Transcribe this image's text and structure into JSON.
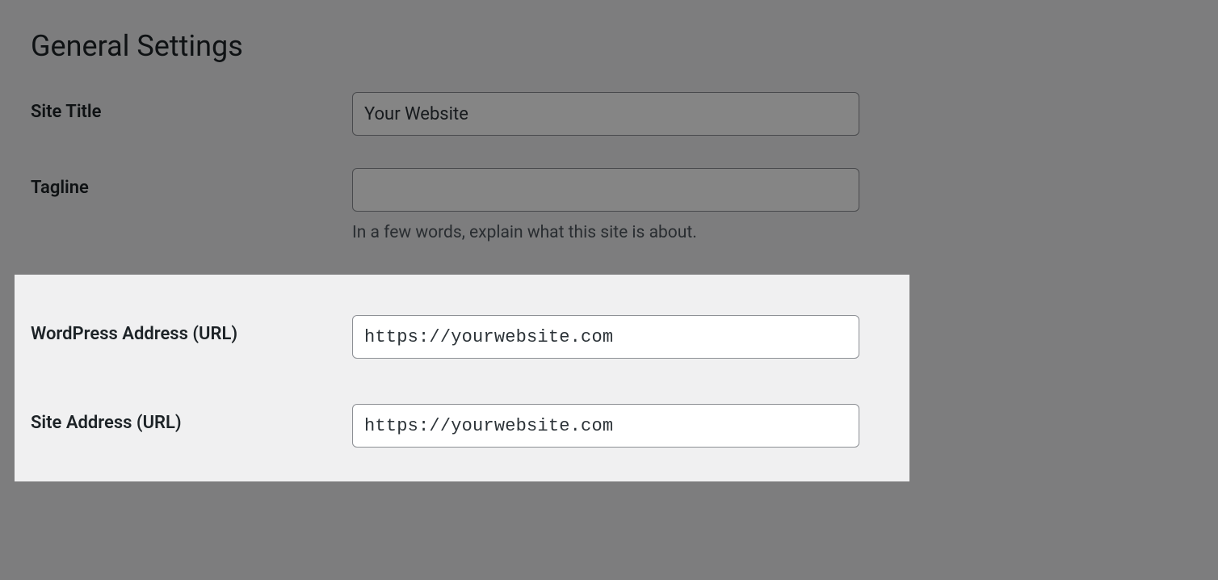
{
  "page": {
    "title": "General Settings"
  },
  "fields": {
    "site_title": {
      "label": "Site Title",
      "value": "Your Website"
    },
    "tagline": {
      "label": "Tagline",
      "value": "",
      "description": "In a few words, explain what this site is about."
    },
    "wp_address": {
      "label": "WordPress Address (URL)",
      "value": "https://yourwebsite.com"
    },
    "site_address": {
      "label": "Site Address (URL)",
      "value": "https://yourwebsite.com"
    }
  }
}
